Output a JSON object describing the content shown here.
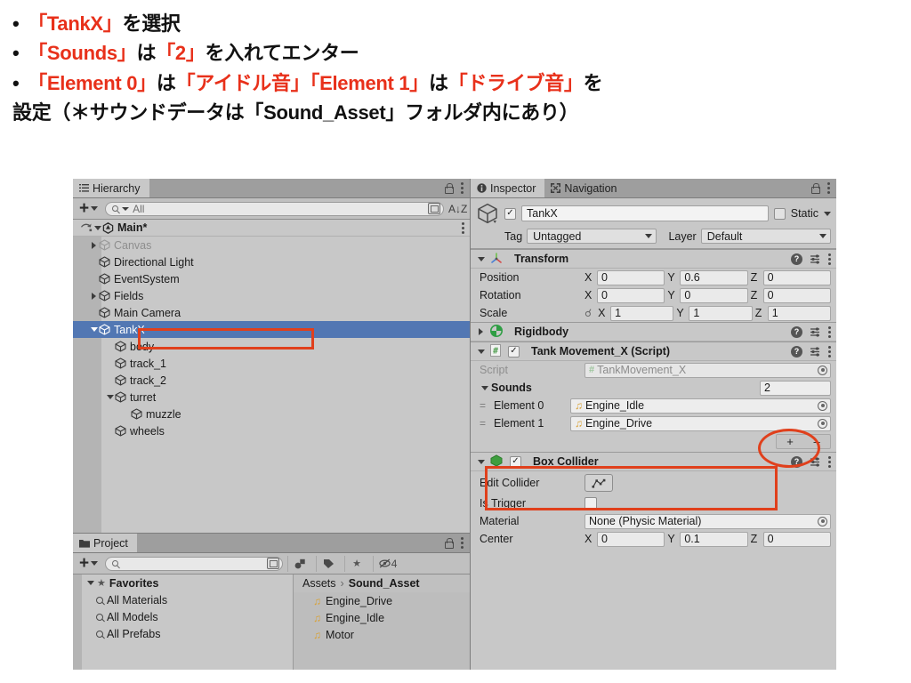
{
  "instructions": [
    {
      "bullet": "•",
      "segments": [
        {
          "t": "「TankX」",
          "c": "red"
        },
        {
          "t": "を選択",
          "c": "black"
        }
      ]
    },
    {
      "bullet": "•",
      "segments": [
        {
          "t": "「Sounds」",
          "c": "red"
        },
        {
          "t": "は",
          "c": "black"
        },
        {
          "t": "「2」",
          "c": "red"
        },
        {
          "t": "を入れてエンター",
          "c": "black"
        }
      ]
    },
    {
      "bullet": "•",
      "segments": [
        {
          "t": "「Element 0」",
          "c": "red"
        },
        {
          "t": "は",
          "c": "black"
        },
        {
          "t": "「アイドル音」",
          "c": "red"
        },
        {
          "t": "「Element 1」",
          "c": "red"
        },
        {
          "t": "は",
          "c": "black"
        },
        {
          "t": "「ドライブ音」",
          "c": "red"
        },
        {
          "t": "を",
          "c": "black"
        }
      ]
    },
    {
      "bullet": "",
      "segments": [
        {
          "t": "設定（＊サウンドデータは「Sound_Asset」フォルダ内にあり）",
          "c": "black"
        }
      ]
    }
  ],
  "hierarchy": {
    "tab_label": "Hierarchy",
    "search_placeholder": "All",
    "plus_label": "+",
    "sort_label": "A↓Z",
    "items": [
      {
        "label": "Main*",
        "depth": 0,
        "arrow": "down",
        "bold": true,
        "scene": true,
        "selected": false,
        "dim": false
      },
      {
        "label": "Canvas",
        "depth": 1,
        "arrow": "right",
        "bold": false,
        "scene": false,
        "selected": false,
        "dim": true
      },
      {
        "label": "Directional Light",
        "depth": 1,
        "arrow": "none",
        "bold": false,
        "scene": false,
        "selected": false,
        "dim": false
      },
      {
        "label": "EventSystem",
        "depth": 1,
        "arrow": "none",
        "bold": false,
        "scene": false,
        "selected": false,
        "dim": false
      },
      {
        "label": "Fields",
        "depth": 1,
        "arrow": "right",
        "bold": false,
        "scene": false,
        "selected": false,
        "dim": false
      },
      {
        "label": "Main Camera",
        "depth": 1,
        "arrow": "none",
        "bold": false,
        "scene": false,
        "selected": false,
        "dim": false
      },
      {
        "label": "TankX",
        "depth": 1,
        "arrow": "down",
        "bold": false,
        "scene": false,
        "selected": true,
        "dim": false
      },
      {
        "label": "body",
        "depth": 2,
        "arrow": "none",
        "bold": false,
        "scene": false,
        "selected": false,
        "dim": false
      },
      {
        "label": "track_1",
        "depth": 2,
        "arrow": "none",
        "bold": false,
        "scene": false,
        "selected": false,
        "dim": false
      },
      {
        "label": "track_2",
        "depth": 2,
        "arrow": "none",
        "bold": false,
        "scene": false,
        "selected": false,
        "dim": false
      },
      {
        "label": "turret",
        "depth": 2,
        "arrow": "down",
        "bold": false,
        "scene": false,
        "selected": false,
        "dim": false
      },
      {
        "label": "muzzle",
        "depth": 3,
        "arrow": "none",
        "bold": false,
        "scene": false,
        "selected": false,
        "dim": false
      },
      {
        "label": "wheels",
        "depth": 2,
        "arrow": "none",
        "bold": false,
        "scene": false,
        "selected": false,
        "dim": false
      }
    ]
  },
  "project": {
    "tab_label": "Project",
    "search_placeholder": "",
    "hidden_count": "4",
    "favorites_label": "Favorites",
    "favorites": [
      "All Materials",
      "All Models",
      "All Prefabs"
    ],
    "breadcrumb_root": "Assets",
    "breadcrumb_sep": "›",
    "breadcrumb_current": "Sound_Asset",
    "assets": [
      "Engine_Drive",
      "Engine_Idle",
      "Motor"
    ]
  },
  "inspector": {
    "tab_label": "Inspector",
    "tab2_label": "Navigation",
    "object_name": "TankX",
    "enabled_check": "✓",
    "static_label": "Static",
    "tag_label": "Tag",
    "tag_value": "Untagged",
    "layer_label": "Layer",
    "layer_value": "Default",
    "components": [
      {
        "name": "Transform",
        "expanded": true,
        "rows": [
          {
            "label": "Position",
            "axes": [
              {
                "a": "X",
                "v": "0"
              },
              {
                "a": "Y",
                "v": "0.6"
              },
              {
                "a": "Z",
                "v": "0"
              }
            ]
          },
          {
            "label": "Rotation",
            "axes": [
              {
                "a": "X",
                "v": "0"
              },
              {
                "a": "Y",
                "v": "0"
              },
              {
                "a": "Z",
                "v": "0"
              }
            ]
          },
          {
            "label": "Scale",
            "axes": [
              {
                "a": "X",
                "v": "1"
              },
              {
                "a": "Y",
                "v": "1"
              },
              {
                "a": "Z",
                "v": "1"
              }
            ]
          }
        ]
      },
      {
        "name": "Rigidbody",
        "expanded": false,
        "rows": []
      },
      {
        "name": "Tank Movement_X (Script)",
        "expanded": true,
        "rows": []
      }
    ],
    "script_label": "Script",
    "script_value": "TankMovement_X",
    "sounds_label": "Sounds",
    "sounds_size": "2",
    "sound_elements": [
      {
        "label": "Element 0",
        "value": "Engine_Idle"
      },
      {
        "label": "Element 1",
        "value": "Engine_Drive"
      }
    ],
    "plus_label": "+",
    "minus_label": "–",
    "box_collider": {
      "name": "Box Collider",
      "edit_collider_label": "Edit Collider",
      "is_trigger_label": "Is Trigger",
      "material_label": "Material",
      "material_value": "None (Physic Material)",
      "center_label": "Center",
      "center": [
        {
          "a": "X",
          "v": "0"
        },
        {
          "a": "Y",
          "v": "0.1"
        },
        {
          "a": "Z",
          "v": "0"
        }
      ]
    }
  },
  "colors": {
    "accent_red": "#e0401c",
    "selection_blue": "#5277b3",
    "panel_bg": "#c8c8c8",
    "note_yellow": "#d9a236",
    "script_green": "#4f9e4f"
  }
}
